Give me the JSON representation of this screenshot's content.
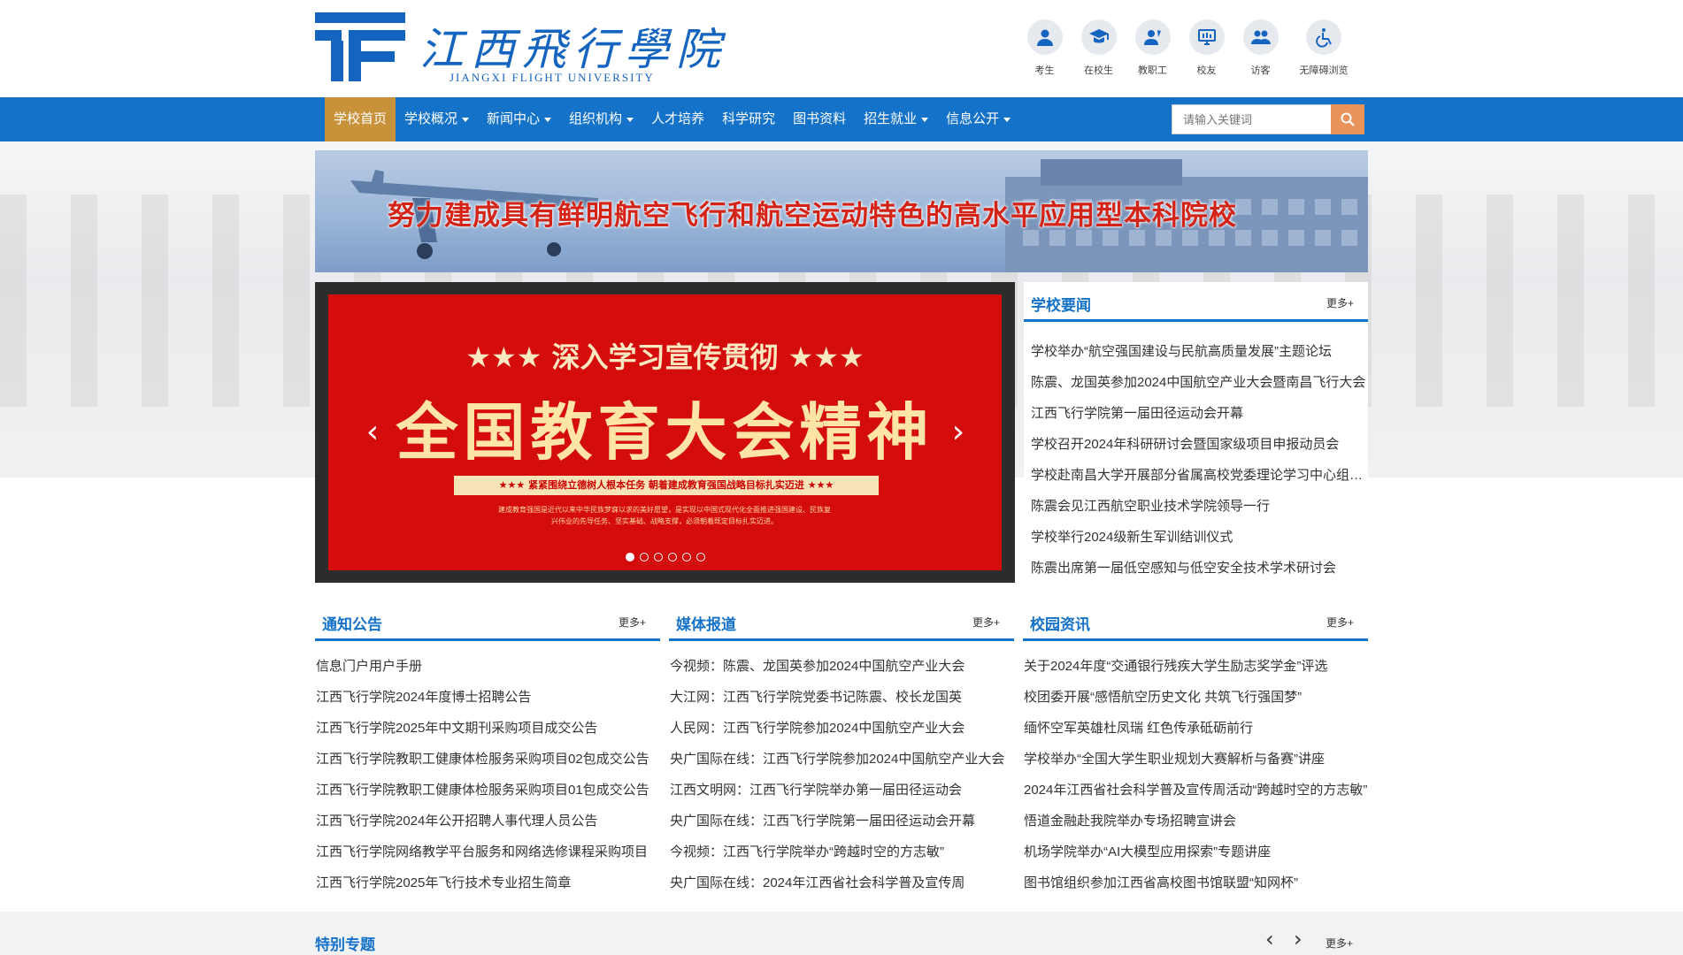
{
  "header": {
    "logo_cn": "江西飛行學院",
    "logo_en": "JIANGXI FLIGHT UNIVERSITY",
    "quick_links": [
      {
        "label": "考生",
        "icon": "examinee-icon"
      },
      {
        "label": "在校生",
        "icon": "graduate-cap-icon"
      },
      {
        "label": "教职工",
        "icon": "staff-icon"
      },
      {
        "label": "校友",
        "icon": "alumni-monitor-icon"
      },
      {
        "label": "访客",
        "icon": "visitors-icon"
      },
      {
        "label": "无障碍浏览",
        "icon": "accessibility-icon"
      }
    ]
  },
  "nav": {
    "items": [
      {
        "label": "学校首页",
        "dropdown": false,
        "active": true
      },
      {
        "label": "学校概况",
        "dropdown": true
      },
      {
        "label": "新闻中心",
        "dropdown": true
      },
      {
        "label": "组织机构",
        "dropdown": true
      },
      {
        "label": "人才培养",
        "dropdown": false
      },
      {
        "label": "科学研究",
        "dropdown": false
      },
      {
        "label": "图书资料",
        "dropdown": false
      },
      {
        "label": "招生就业",
        "dropdown": true
      },
      {
        "label": "信息公开",
        "dropdown": true
      }
    ],
    "search_placeholder": "请输入关键词"
  },
  "banner": {
    "text": "努力建成具有鲜明航空飞行和航空运动特色的高水平应用型本科院校"
  },
  "carousel": {
    "subtitle": "★★★ 深入学习宣传贯彻 ★★★",
    "title": "全国教育大会精神",
    "bar_text": "★★★ 紧紧围绕立德树人根本任务 朝着建成教育强国战略目标扎实迈进 ★★★",
    "small_text": "建成教育强国是近代以来中华民族梦寐以求的美好愿望，是实现以中国式现代化全面推进强国建设、民族复兴伟业的先导任务、坚实基础、战略支撑，必须朝着既定目标扎实迈进。",
    "slide_count": 6,
    "active_index": 0,
    "prev_symbol": "‹",
    "next_symbol": "›"
  },
  "news": {
    "title": "学校要闻",
    "more": "更多+",
    "items": [
      "学校举办“航空强国建设与民航高质量发展”主题论坛",
      "陈震、龙国英参加2024中国航空产业大会暨南昌飞行大会",
      "江西飞行学院第一届田径运动会开幕",
      "学校召开2024年科研研讨会暨国家级项目申报动员会",
      "学校赴南昌大学开展部分省属高校党委理论学习中心组联学",
      "陈震会见江西航空职业技术学院领导一行",
      "学校举行2024级新生军训结训仪式",
      "陈震出席第一届低空感知与低空安全技术学术研讨会"
    ]
  },
  "notices": {
    "title": "通知公告",
    "more": "更多+",
    "items": [
      "信息门户用户手册",
      "江西飞行学院2024年度博士招聘公告",
      "江西飞行学院2025年中文期刊采购项目成交公告",
      "江西飞行学院教职工健康体检服务采购项目02包成交公告",
      "江西飞行学院教职工健康体检服务采购项目01包成交公告",
      "江西飞行学院2024年公开招聘人事代理人员公告",
      "江西飞行学院网络教学平台服务和网络选修课程采购项目",
      "江西飞行学院2025年飞行技术专业招生简章"
    ]
  },
  "media": {
    "title": "媒体报道",
    "more": "更多+",
    "items": [
      "今视频：陈震、龙国英参加2024中国航空产业大会",
      "大江网：江西飞行学院党委书记陈震、校长龙国英",
      "人民网：江西飞行学院参加2024中国航空产业大会",
      "央广国际在线：江西飞行学院参加2024中国航空产业大会",
      "江西文明网：江西飞行学院举办第一届田径运动会",
      "央广国际在线：江西飞行学院第一届田径运动会开幕",
      "今视频：江西飞行学院举办“跨越时空的方志敏”",
      "央广国际在线：2024年江西省社会科学普及宣传周"
    ]
  },
  "campus": {
    "title": "校园资讯",
    "more": "更多+",
    "items": [
      "关于2024年度“交通银行残疾大学生励志奖学金”评选",
      "校团委开展“感悟航空历史文化 共筑飞行强国梦”",
      "缅怀空军英雄杜凤瑞 红色传承砥砺前行",
      "学校举办“全国大学生职业规划大赛解析与备赛”讲座",
      "2024年江西省社会科学普及宣传周活动“跨越时空的方志敏”",
      "悟道金融赴我院举办专场招聘宣讲会",
      "机场学院举办“AI大模型应用探索”专题讲座",
      "图书馆组织参加江西省高校图书馆联盟“知网杯”"
    ]
  },
  "special": {
    "title": "特别专题",
    "prev": "‹",
    "next": "›",
    "more": "更多+"
  },
  "colors": {
    "brand_blue": "#1472c8",
    "nav_active": "#c8923a",
    "search_button": "#e9935a",
    "slide_red": "#d40c0c"
  }
}
